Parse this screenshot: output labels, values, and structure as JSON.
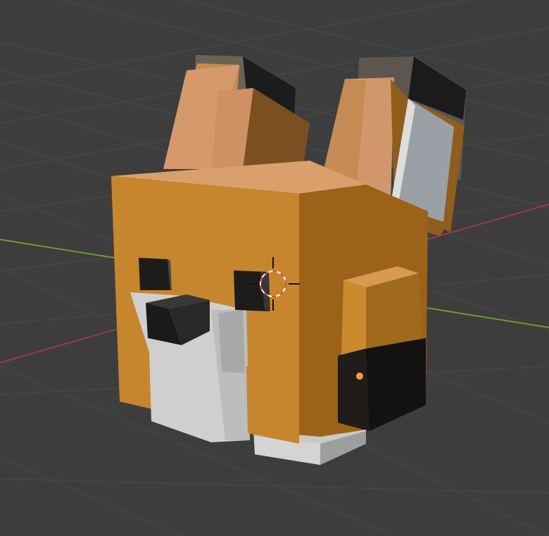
{
  "viewport": {
    "label": "",
    "colors": {
      "background": "#3d3d3d",
      "grid_line": "#4a4a4a",
      "x_axis": "#9a3a4a",
      "y_axis": "#6f9a2e",
      "fox_orange": "#c98a2e",
      "fox_orange_dark": "#9a6418",
      "fox_light": "#d9a066",
      "fox_white": "#d2d2d2",
      "fox_black": "#1e1c1a",
      "origin": "#ff9a3a"
    },
    "objects": [
      {
        "name": "fox-head-model",
        "type": "mesh"
      },
      {
        "name": "3d-cursor",
        "type": "cursor"
      },
      {
        "name": "object-origin",
        "type": "origin"
      }
    ]
  }
}
